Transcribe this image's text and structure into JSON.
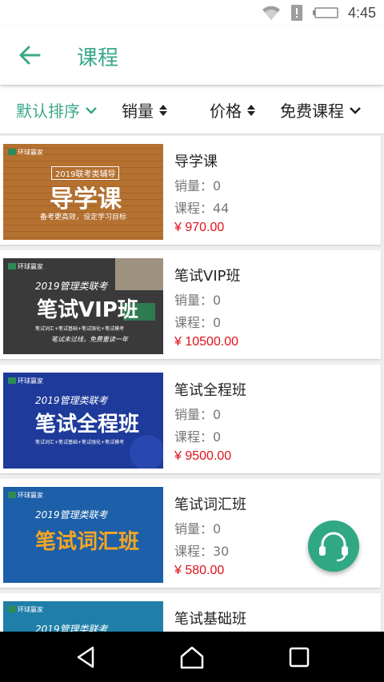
{
  "status_bar": {
    "time": "4:45",
    "icons": [
      "wifi-icon",
      "alert-icon",
      "battery-icon"
    ]
  },
  "header": {
    "title": "课程",
    "back_icon": "arrow-left-icon"
  },
  "filters": [
    {
      "label": "默认排序",
      "icon": "chevron-down-icon",
      "active": true
    },
    {
      "label": "销量",
      "icon": "sort-updown-icon",
      "active": false
    },
    {
      "label": "价格",
      "icon": "sort-updown-icon",
      "active": false
    },
    {
      "label": "免费课程",
      "icon": "chevron-down-icon",
      "active": false
    }
  ],
  "meta_labels": {
    "sales": "销量：",
    "lessons": "课程："
  },
  "courses": [
    {
      "name": "导学课",
      "sales": "销量：0",
      "lessons": "课程：44",
      "price": "¥ 970.00",
      "thumb": {
        "logo": "环球赢家",
        "subtitle": "2019联考类辅导",
        "headline": "导学课",
        "tagline": "备考更高效，设定学习目标"
      }
    },
    {
      "name": "笔试VIP班",
      "sales": "销量：0",
      "lessons": "课程：0",
      "price": "¥ 10500.00",
      "thumb": {
        "logo": "环球赢家",
        "subtitle": "2019管理类联考",
        "headline": "笔试VIP班",
        "tagline": "笔试词汇+笔试基础+笔试强化+笔试模考",
        "tagline2": "笔试未过线，免费重读一年"
      }
    },
    {
      "name": "笔试全程班",
      "sales": "销量：0",
      "lessons": "课程：0",
      "price": "¥ 9500.00",
      "thumb": {
        "logo": "环球赢家",
        "subtitle": "2019管理类联考",
        "headline": "笔试全程班",
        "tagline": "笔试词汇+笔试基础+笔试强化+笔试模考"
      }
    },
    {
      "name": "笔试词汇班",
      "sales": "销量：0",
      "lessons": "课程：30",
      "price": "¥ 580.00",
      "thumb": {
        "logo": "环球赢家",
        "subtitle": "2019管理类联考",
        "headline": "笔试词汇班"
      }
    },
    {
      "name": "笔试基础班",
      "sales": "",
      "lessons": "",
      "price": "",
      "thumb": {
        "logo": "环球赢家",
        "subtitle": "2019管理类联考",
        "headline": ""
      }
    }
  ],
  "fab": {
    "icon": "headset-icon"
  },
  "nav": {
    "icons": [
      "back-triangle-icon",
      "home-icon",
      "recents-icon"
    ]
  },
  "colors": {
    "accent": "#3aa888",
    "price": "#e0121b",
    "fab": "#2fa883"
  }
}
